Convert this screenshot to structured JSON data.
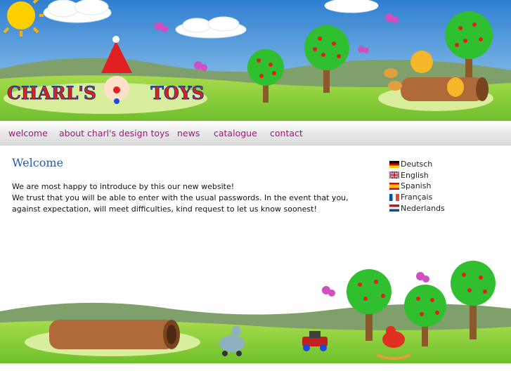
{
  "header": {
    "logo_left": "CHARL'S",
    "logo_right": "TOYS"
  },
  "nav": {
    "items": [
      {
        "label": "welcome"
      },
      {
        "label": "about charl's design toys"
      },
      {
        "label": "news"
      },
      {
        "label": "catalogue"
      },
      {
        "label": "contact"
      }
    ]
  },
  "main": {
    "title": "Welcome",
    "line1": "We are most happy to introduce by this our new website!",
    "line2": "We trust that you will be able to enter with the usual passwords. In the event that you, against expectation, will meet difficulties, kind request to let us know soonest!"
  },
  "languages": [
    {
      "label": "Deutsch",
      "icon": "german-flag-icon"
    },
    {
      "label": "English",
      "icon": "uk-flag-icon"
    },
    {
      "label": "Spanish",
      "icon": "spanish-flag-icon"
    },
    {
      "label": "Français",
      "icon": "french-flag-icon"
    },
    {
      "label": "Nederlands",
      "icon": "dutch-flag-icon"
    }
  ],
  "colors": {
    "nav_link": "#a8117e",
    "title": "#2a5aa6",
    "sky": "#3a8fd8",
    "grass": "#8fd040"
  }
}
